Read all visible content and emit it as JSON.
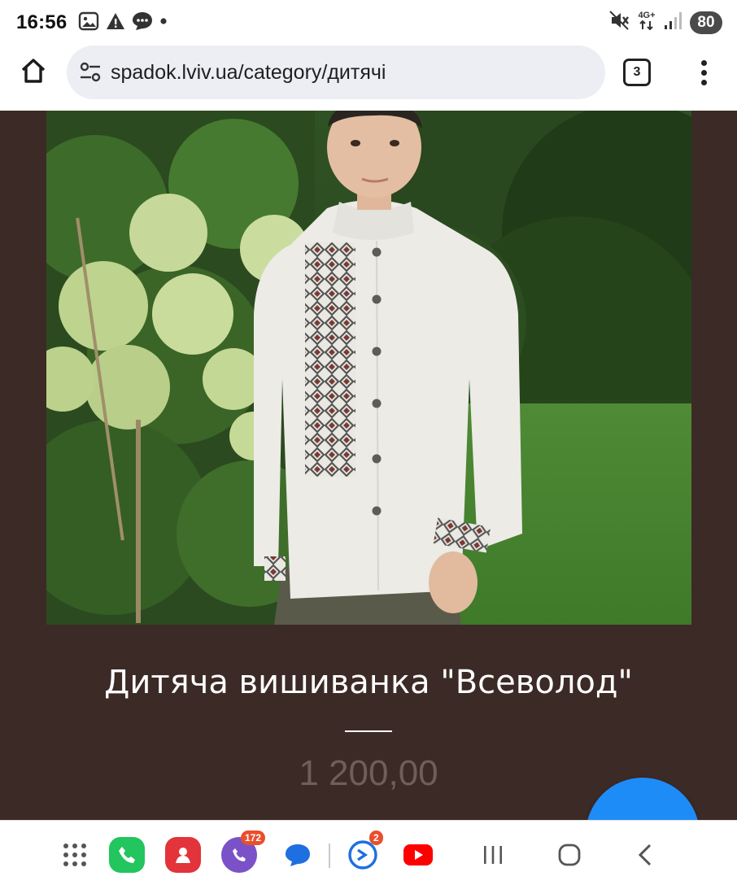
{
  "status_bar": {
    "time": "16:56",
    "left_icons": [
      "screenshot-icon",
      "alert-icon",
      "message-icon",
      "dot-icon"
    ],
    "network": "4G+",
    "battery": "80"
  },
  "browser": {
    "url": "spadok.lviv.ua/category/дитячі",
    "tab_count": "3"
  },
  "product": {
    "title": "Дитяча вишиванка \"Всеволод\"",
    "price": "1 200,00"
  },
  "nav_bar": {
    "apps": [
      {
        "name": "app-drawer",
        "badge": ""
      },
      {
        "name": "phone",
        "color": "#22c55e",
        "badge": ""
      },
      {
        "name": "contacts",
        "color": "#e2343a",
        "badge": ""
      },
      {
        "name": "viber",
        "color": "#7b51c8",
        "badge": "172"
      },
      {
        "name": "messages",
        "color": "#1e6fe0",
        "badge": ""
      },
      {
        "name": "edge",
        "color": "#1e6fe0",
        "badge": "2"
      },
      {
        "name": "youtube",
        "color": "#ff0000",
        "badge": ""
      }
    ],
    "viber_badge": "172",
    "edge_badge": "2"
  },
  "colors": {
    "page_background": "#3c2a26",
    "chat_button": "#1e8cf7",
    "price_text": "#6e5f5b"
  }
}
